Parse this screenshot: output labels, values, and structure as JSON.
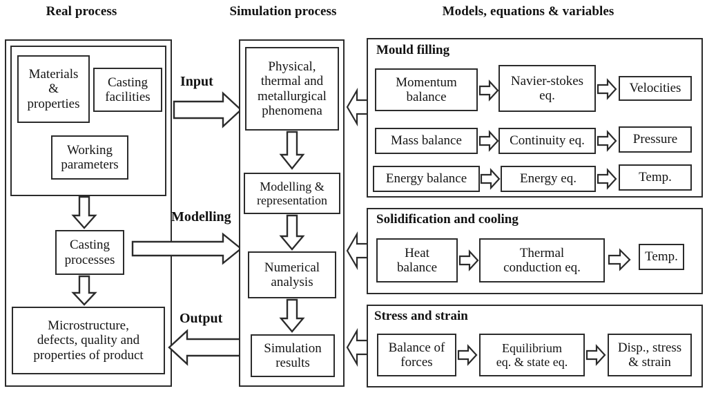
{
  "diagram": {
    "title_columns": [
      {
        "id": "real-process",
        "label": "Real process"
      },
      {
        "id": "simulation-process",
        "label": "Simulation process"
      },
      {
        "id": "models-equations-variables",
        "label": "Models, equations & variables"
      }
    ],
    "real_process": {
      "inputs_group": [
        {
          "id": "materials-properties",
          "label": "Materials\n&\nproperties"
        },
        {
          "id": "casting-facilities",
          "label": "Casting\nfacilities"
        },
        {
          "id": "working-parameters",
          "label": "Working\nparameters"
        }
      ],
      "casting_processes": {
        "id": "casting-processes",
        "label": "Casting\nprocesses"
      },
      "outcome": {
        "id": "microstructure-outcome",
        "label": "Microstructure,\ndefects, quality and\nproperties of product"
      }
    },
    "simulation_process": {
      "steps": [
        {
          "id": "phenomena",
          "label": "Physical,\nthermal and\nmetallurgical\nphenomena"
        },
        {
          "id": "modelling-representation",
          "label": "Modelling &\nrepresentation"
        },
        {
          "id": "numerical-analysis",
          "label": "Numerical\nanalysis"
        },
        {
          "id": "simulation-results",
          "label": "Simulation\nresults"
        }
      ]
    },
    "connector_labels": {
      "input": "Input",
      "modelling": "Modelling",
      "output": "Output"
    },
    "models_panels": [
      {
        "id": "mould-filling",
        "title": "Mould filling",
        "rows": [
          {
            "balance": "Momentum\nbalance",
            "equation": "Navier-stokes\neq.",
            "variable": "Velocities"
          },
          {
            "balance": "Mass balance",
            "equation": "Continuity eq.",
            "variable": "Pressure"
          },
          {
            "balance": "Energy balance",
            "equation": "Energy eq.",
            "variable": "Temp."
          }
        ]
      },
      {
        "id": "solidification-and-cooling",
        "title": "Solidification and cooling",
        "rows": [
          {
            "balance": "Heat\nbalance",
            "equation": "Thermal\nconduction eq.",
            "variable": "Temp."
          }
        ]
      },
      {
        "id": "stress-and-strain",
        "title": "Stress and strain",
        "rows": [
          {
            "balance": "Balance of\nforces",
            "equation": "Equilibrium\neq. & state eq.",
            "variable": "Disp., stress\n& strain"
          }
        ]
      }
    ],
    "colors": {
      "line": "#2b2b2b",
      "text": "#141414",
      "background": "#ffffff"
    }
  }
}
